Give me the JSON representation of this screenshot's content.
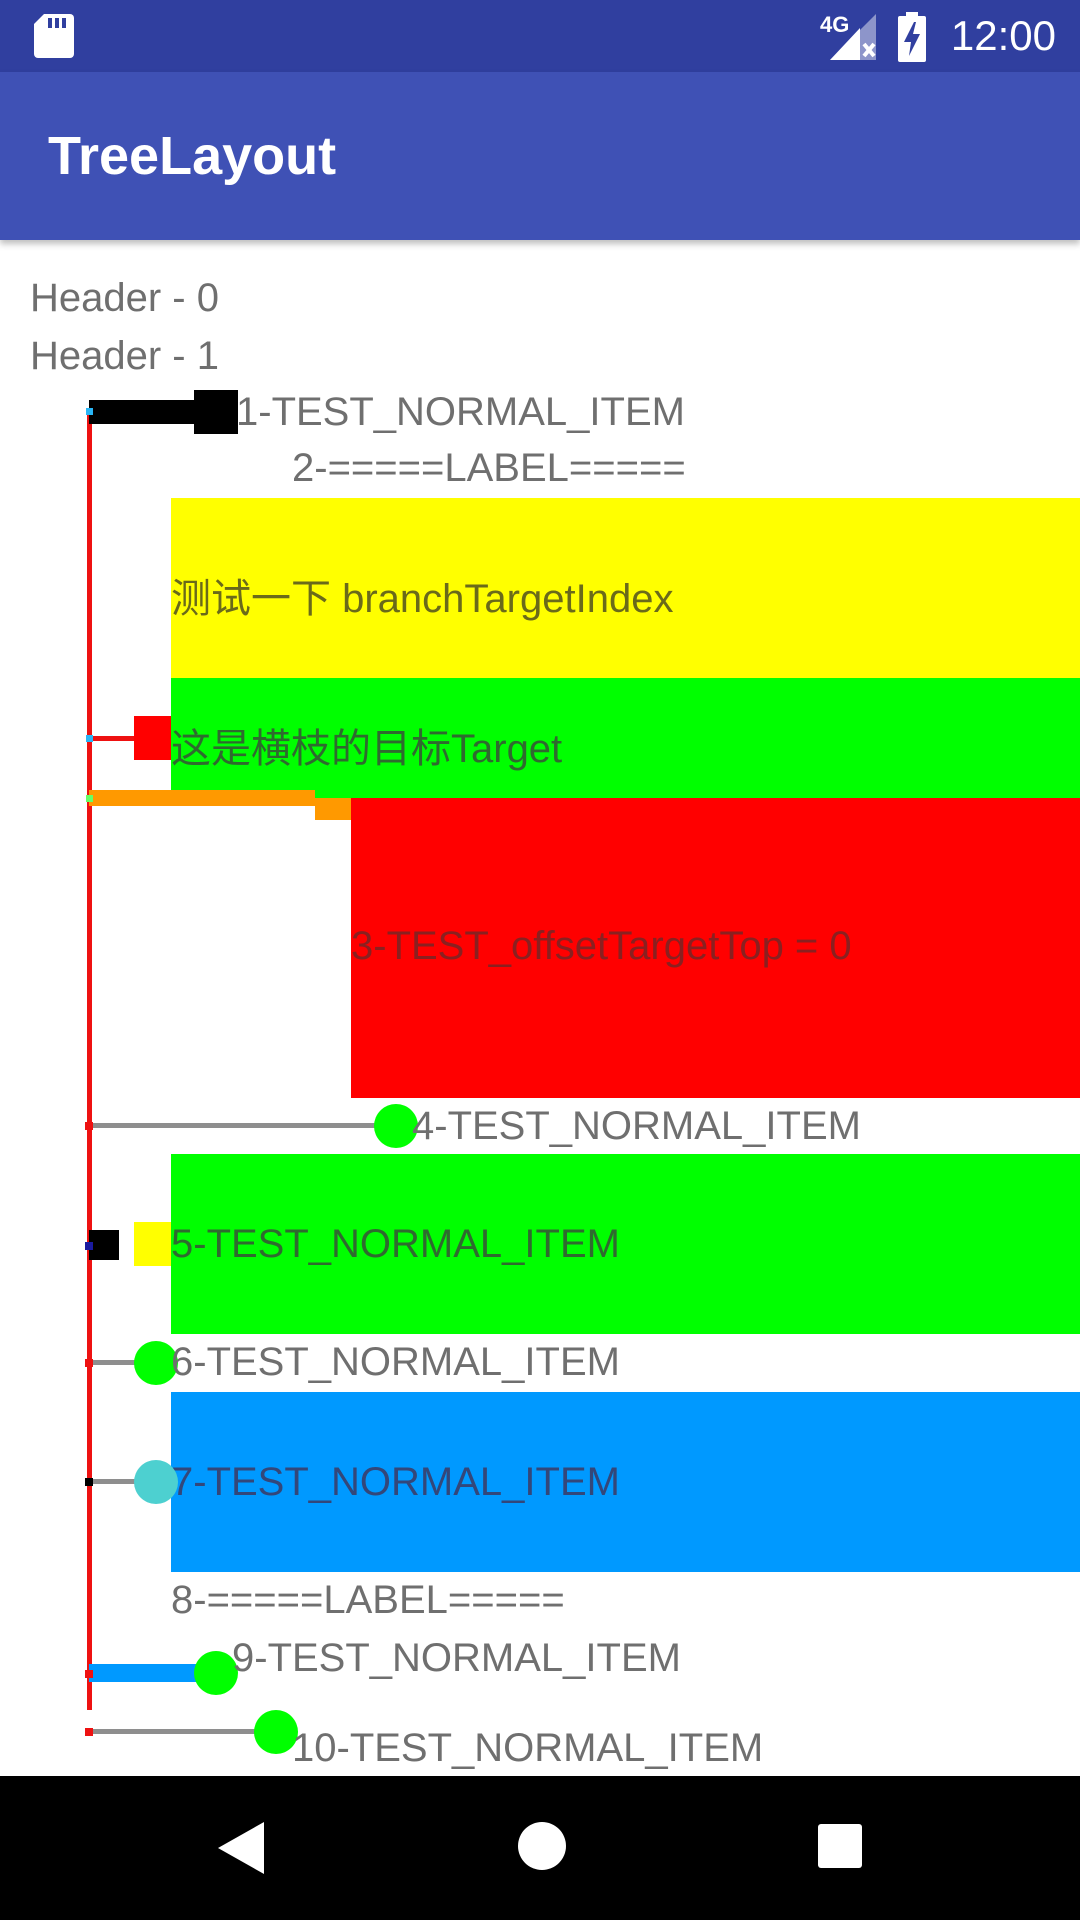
{
  "status_bar": {
    "network": "4G",
    "time": "12:00"
  },
  "app_bar": {
    "title": "TreeLayout"
  },
  "headers": [
    "Header - 0",
    "Header - 1"
  ],
  "items": {
    "item1": "1-TEST_NORMAL_ITEM",
    "item2": "2-=====LABEL=====",
    "branch_test": "测试一下 branchTargetIndex",
    "branch_target": "这是横枝的目标Target",
    "item3": "3-TEST_offsetTargetTop = 0",
    "item4": "4-TEST_NORMAL_ITEM",
    "item5": "5-TEST_NORMAL_ITEM",
    "item6": "6-TEST_NORMAL_ITEM",
    "item7": "7-TEST_NORMAL_ITEM",
    "item8": "8-=====LABEL=====",
    "item9": "9-TEST_NORMAL_ITEM",
    "item10": "10-TEST_NORMAL_ITEM"
  },
  "colors": {
    "status_bar": "#303F9F",
    "app_bar": "#3F51B5",
    "trunk": "#EE1111",
    "yellow": "#FFFF00",
    "green": "#00FF00",
    "red": "#FF0000",
    "blue": "#0099FF",
    "orange": "#FF9900",
    "cyan": "#4DD0D0",
    "gray": "#8E8E8E"
  },
  "icons": [
    "sd-card-icon",
    "signal-4g-icon",
    "battery-charging-icon",
    "back-icon",
    "home-icon",
    "recents-icon"
  ]
}
